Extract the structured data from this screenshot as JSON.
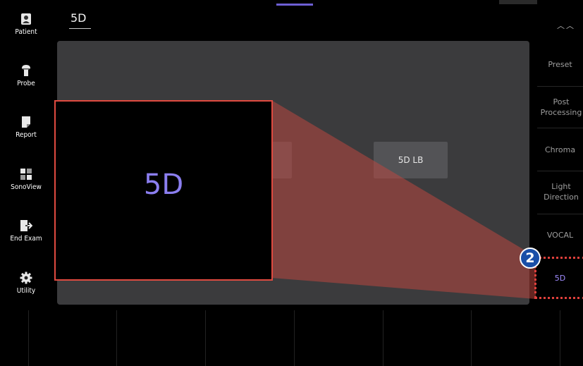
{
  "left_bar": {
    "items": [
      {
        "label": "Patient",
        "icon": "patient-icon"
      },
      {
        "label": "Probe",
        "icon": "probe-icon"
      },
      {
        "label": "Report",
        "icon": "report-icon"
      },
      {
        "label": "SonoView",
        "icon": "sonoview-icon"
      },
      {
        "label": "End Exam",
        "icon": "end-exam-icon"
      },
      {
        "label": "Utility",
        "icon": "gear-icon"
      }
    ]
  },
  "main": {
    "title": "5D",
    "button_5dlb": "5D LB"
  },
  "right_bar": {
    "items": [
      {
        "label": "Preset"
      },
      {
        "label": "Post Processing"
      },
      {
        "label": "Chroma"
      },
      {
        "label": "Light Direction"
      },
      {
        "label": "VOCAL"
      },
      {
        "label": "5D"
      }
    ]
  },
  "callout": {
    "zoom_text": "5D",
    "badge_number": "2"
  },
  "colors": {
    "accent": "#8b7ef0",
    "highlight_red": "#e04a40",
    "badge_blue": "#1a4fa8",
    "panel": "#3b3b3d"
  }
}
